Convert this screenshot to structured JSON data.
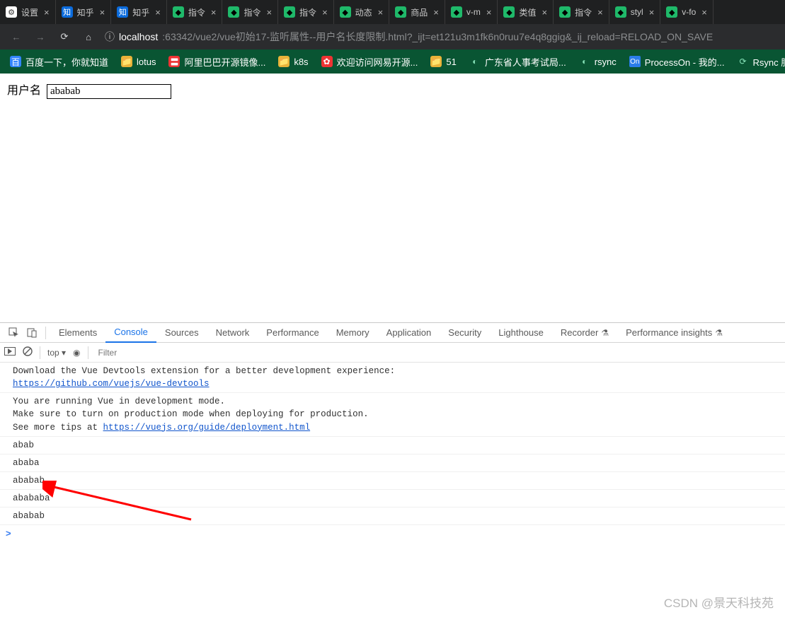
{
  "tabs": [
    {
      "icon_bg": "#ffffff",
      "icon_fg": "#333",
      "icon_label": "⚙",
      "title": "设置"
    },
    {
      "icon_bg": "#0b6bdc",
      "icon_fg": "#fff",
      "icon_label": "知",
      "title": "知乎"
    },
    {
      "icon_bg": "#0b6bdc",
      "icon_fg": "#fff",
      "icon_label": "知",
      "title": "知乎"
    },
    {
      "icon_bg": "#1fb96a",
      "icon_fg": "#000",
      "icon_label": "◆",
      "title": "指令"
    },
    {
      "icon_bg": "#1fb96a",
      "icon_fg": "#000",
      "icon_label": "◆",
      "title": "指令"
    },
    {
      "icon_bg": "#1fb96a",
      "icon_fg": "#000",
      "icon_label": "◆",
      "title": "指令"
    },
    {
      "icon_bg": "#1fb96a",
      "icon_fg": "#000",
      "icon_label": "◆",
      "title": "动态"
    },
    {
      "icon_bg": "#1fb96a",
      "icon_fg": "#000",
      "icon_label": "◆",
      "title": "商品"
    },
    {
      "icon_bg": "#1fb96a",
      "icon_fg": "#000",
      "icon_label": "◆",
      "title": "v-m"
    },
    {
      "icon_bg": "#1fb96a",
      "icon_fg": "#000",
      "icon_label": "◆",
      "title": "类值"
    },
    {
      "icon_bg": "#1fb96a",
      "icon_fg": "#000",
      "icon_label": "◆",
      "title": "指令"
    },
    {
      "icon_bg": "#1fb96a",
      "icon_fg": "#000",
      "icon_label": "◆",
      "title": "styl"
    },
    {
      "icon_bg": "#1fb96a",
      "icon_fg": "#000",
      "icon_label": "◆",
      "title": "v-fo"
    }
  ],
  "addr": {
    "info_icon": "ⓘ",
    "host": "localhost",
    "path": ":63342/vue2/vue初始17-监听属性--用户名长度限制.html?_ijt=et121u3m1fk6n0ruu7e4q8ggig&_ij_reload=RELOAD_ON_SAVE"
  },
  "bookmarks": [
    {
      "cls": "baidu-icon",
      "icon": "百",
      "label": "百度一下，你就知道"
    },
    {
      "cls": "folder-icon",
      "icon": "📁",
      "label": "lotus"
    },
    {
      "cls": "red-icon",
      "icon": "〓",
      "label": "阿里巴巴开源镜像..."
    },
    {
      "cls": "folder-icon",
      "icon": "📁",
      "label": "k8s"
    },
    {
      "cls": "red-icon",
      "icon": "✿",
      "label": "欢迎访问网易开源..."
    },
    {
      "cls": "folder-icon",
      "icon": "📁",
      "label": "51"
    },
    {
      "cls": "clear-icon",
      "icon": "◐",
      "label": "广东省人事考试局..."
    },
    {
      "cls": "clear-icon",
      "icon": "◐",
      "label": "rsync"
    },
    {
      "cls": "",
      "icon": "On",
      "label": "ProcessOn - 我的..."
    },
    {
      "cls": "clear-icon",
      "icon": "⟳",
      "label": "Rsync 服务部署"
    }
  ],
  "page": {
    "label": "用户名",
    "input_value": "ababab"
  },
  "devtools": {
    "tabs": [
      "Elements",
      "Console",
      "Sources",
      "Network",
      "Performance",
      "Memory",
      "Application",
      "Security",
      "Lighthouse",
      "Recorder",
      "Performance insights"
    ],
    "active_tab": "Console",
    "toolbar": {
      "context": "top ▾",
      "filter_placeholder": "Filter"
    },
    "logs": [
      {
        "html": "Download the Vue Devtools extension for a better development experience:\n<a>https://github.com/vuejs/vue-devtools</a>"
      },
      {
        "html": "You are running Vue in development mode.\nMake sure to turn on production mode when deploying for production.\nSee more tips at <a>https://vuejs.org/guide/deployment.html</a>"
      },
      {
        "html": "abab"
      },
      {
        "html": "ababa"
      },
      {
        "html": "ababab"
      },
      {
        "html": "abababa"
      },
      {
        "html": "ababab"
      }
    ],
    "prompt": ">"
  },
  "watermark": "CSDN @景天科技苑"
}
